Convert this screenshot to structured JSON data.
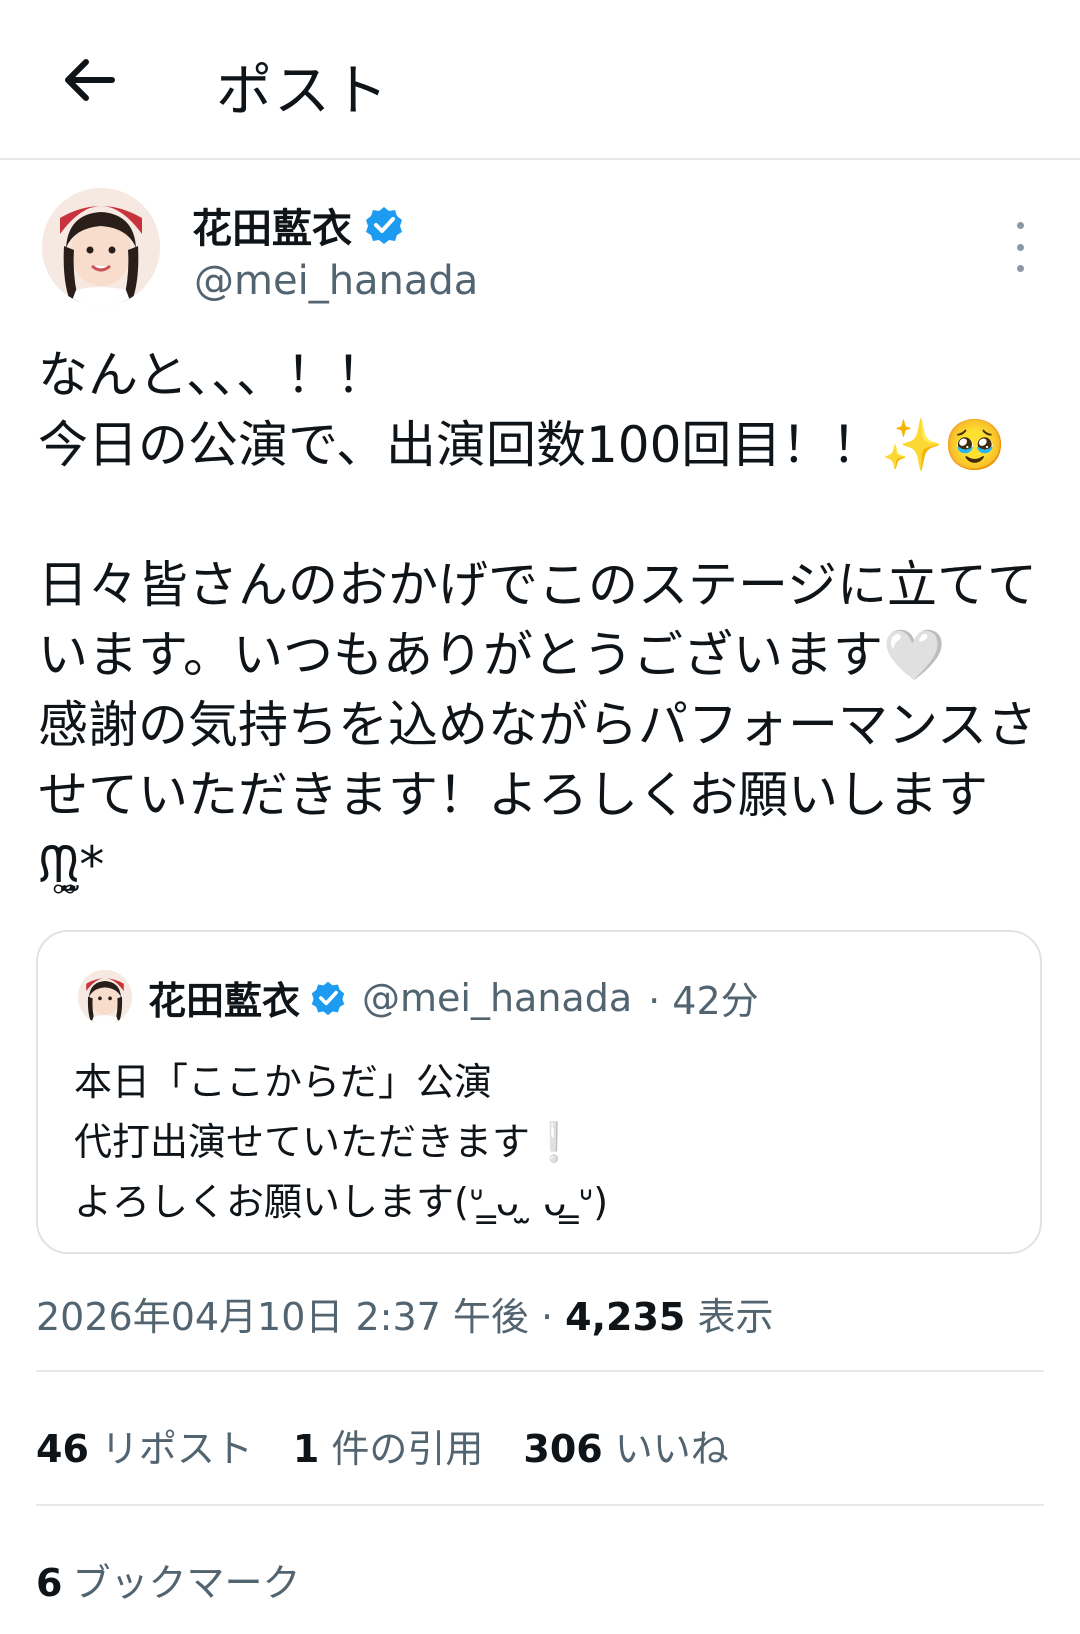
{
  "header": {
    "title": "ポスト"
  },
  "author": {
    "display_name": "花田藍衣",
    "handle": "@mei_hanada",
    "verified": true
  },
  "tweet": {
    "text": "なんと、、、！！\n今日の公演で、出演回数100回目！！✨🥹\n\n日々皆さんのおかげでこのステージに立てています。いつもありがとうございます🤍\n感謝の気持ちを込めながらパフォーマンスさせていただきます！よろしくお願いしますᙏ̤̫͚*"
  },
  "quote": {
    "display_name": "花田藍衣",
    "handle": "@mei_hanada",
    "time": "· 42分",
    "text": "本日「ここからだ」公演\n代打出演せていただきます❕\nよろしくお願いします(ᐡ ̳ᴗ ̫ ᴗ ̳ᐡ)"
  },
  "meta": {
    "datetime": "2026年04月10日 2:37 午後 ·",
    "views_count": "4,235",
    "views_label": "表示"
  },
  "stats": [
    {
      "count": "46",
      "label": "リポスト"
    },
    {
      "count": "1",
      "label": "件の引用"
    },
    {
      "count": "306",
      "label": "いいね"
    }
  ],
  "bookmarks": {
    "count": "6",
    "label": "ブックマーク"
  },
  "colors": {
    "verified": "#1d9bf0",
    "secondary_text": "#536471"
  }
}
